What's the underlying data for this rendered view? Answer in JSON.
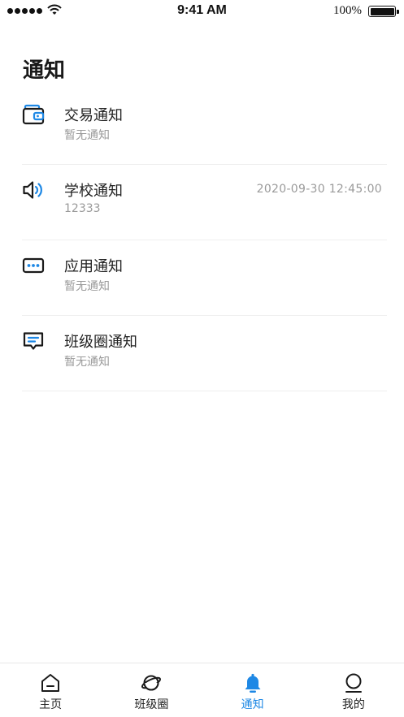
{
  "status_bar": {
    "time": "9:41 AM",
    "battery": "100%"
  },
  "page": {
    "title": "通知"
  },
  "notifications": [
    {
      "icon": "wallet-icon",
      "title": "交易通知",
      "subtitle": "暂无通知",
      "time": ""
    },
    {
      "icon": "speaker-icon",
      "title": "学校通知",
      "subtitle": "12333",
      "time": "2020-09-30 12:45:00"
    },
    {
      "icon": "app-dots-icon",
      "title": "应用通知",
      "subtitle": "暂无通知",
      "time": ""
    },
    {
      "icon": "message-icon",
      "title": "班级圈通知",
      "subtitle": "暂无通知",
      "time": ""
    }
  ],
  "tabbar": {
    "tabs": [
      {
        "label": "主页",
        "icon": "home-icon",
        "active": false
      },
      {
        "label": "班级圈",
        "icon": "planet-icon",
        "active": false
      },
      {
        "label": "通知",
        "icon": "bell-icon",
        "active": true
      },
      {
        "label": "我的",
        "icon": "profile-icon",
        "active": false
      }
    ]
  },
  "colors": {
    "accent": "#1e88e5",
    "text": "#222222",
    "muted": "#9a9a9a"
  }
}
